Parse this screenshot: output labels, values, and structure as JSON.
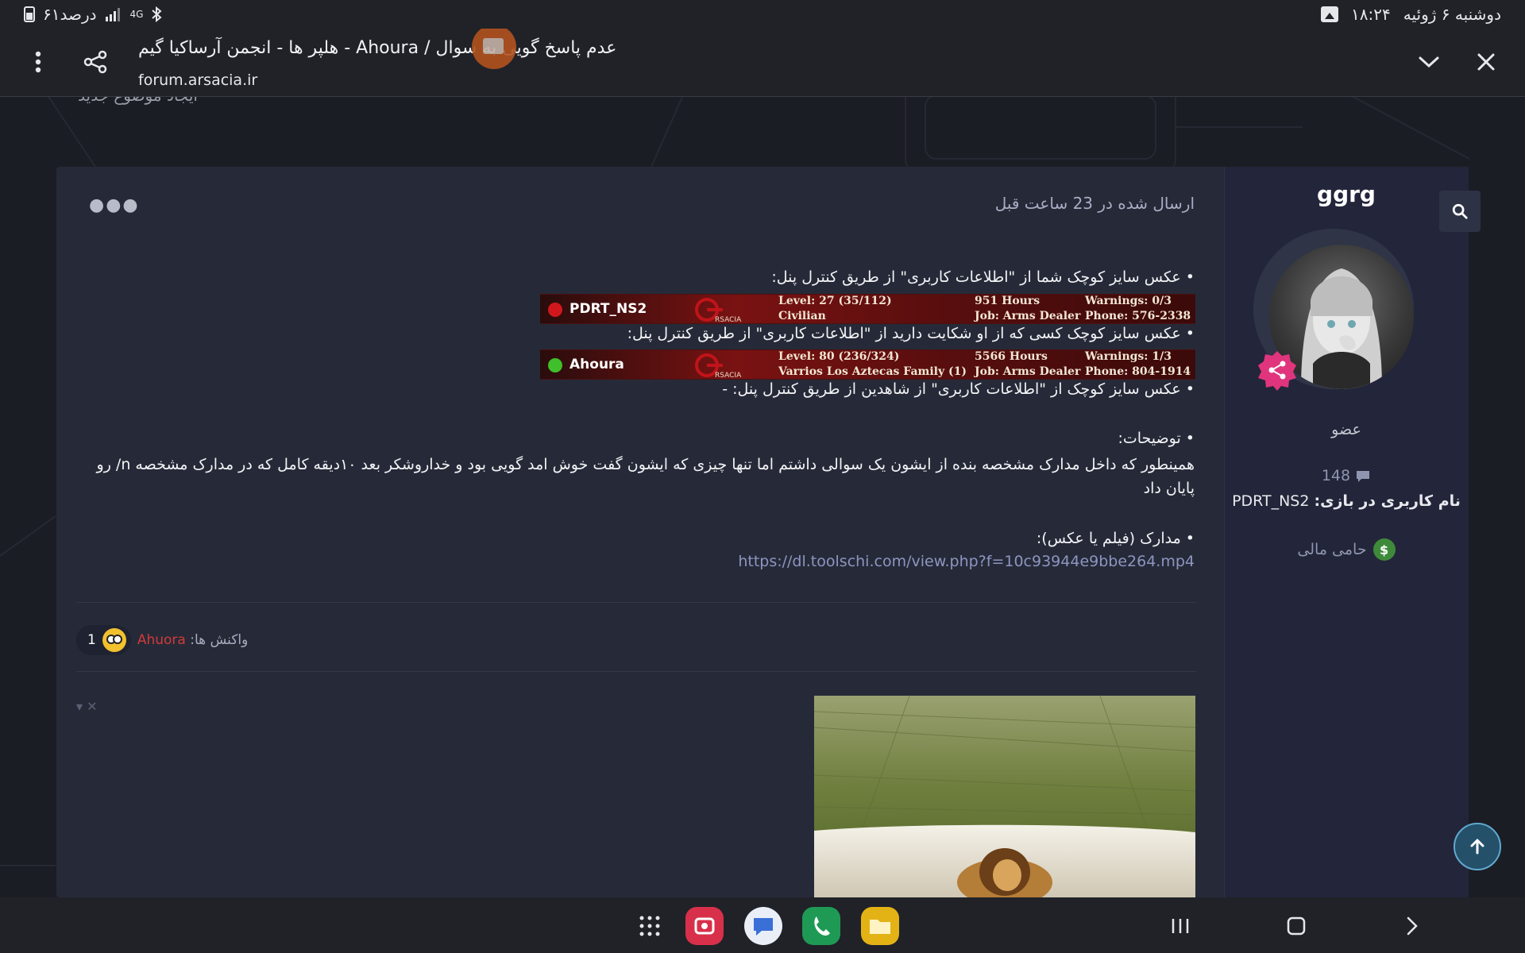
{
  "status_bar": {
    "battery_text": "۶۱درصد",
    "network": "4G",
    "time": "۱۸:۲۴",
    "date": "دوشنبه ۶ ژوئیه"
  },
  "custom_tab": {
    "title": "عدم پاسخ گویی به سوال / Ahoura - هلپر ها - انجمن آرساکیا گیم",
    "url": "forum.arsacia.ir"
  },
  "partial_text": "ایجاد موضوع جدید",
  "author": {
    "username": "ggrg",
    "role": "عضو",
    "post_count": "148",
    "ingame_label": "نام کاربری در بازی:",
    "ingame_name": "PDRT_NS2",
    "donor_label": "حامی مالی"
  },
  "post": {
    "posted_time": "ارسال شده در 23 ساعت قبل",
    "line1": "• عکس سایز کوچک شما از \"اطلاعات کاربری\" از طریق کنترل پنل:",
    "line2": "• عکس سایز کوچک کسی که از او شکایت دارید از \"اطلاعات کاربری\" از طریق کنترل پنل:",
    "line3": "• عکس سایز کوچک از \"اطلاعات کاربری\" از شاهدین از طریق کنترل پنل: -",
    "desc_label": "• توضیحات:",
    "desc_text": "همینطور که داخل مدارک مشخصه بنده از ایشون یک سوالی داشتم اما تنها چیزی که ایشون گفت خوش امد گویی بود و خداروشکر بعد ۱۰دیقه کامل که در مدارک مشخصه n/ رو پایان داد",
    "evidence_label": "• مدارک (فیلم یا عکس):",
    "evidence_link": "https://dl.toolschi.com/view.php?f=10c93944e9bbe264.mp4"
  },
  "signatures": [
    {
      "name": "PDRT_NS2",
      "status_color": "#d0181c",
      "level": "Level: 27 (35/112)",
      "faction": "Civilian",
      "hours": "951 Hours",
      "job": "Job: Arms Dealer",
      "warnings": "Warnings: 0/3",
      "phone": "Phone: 576-2338"
    },
    {
      "name": "Ahoura",
      "status_color": "#3fbf2a",
      "level": "Level: 80 (236/324)",
      "faction": "Varrios Los Aztecas Family (1)",
      "hours": "5566 Hours",
      "job": "Job: Arms Dealer",
      "warnings": "Warnings: 1/3",
      "phone": "Phone: 804-1914"
    }
  ],
  "reactions": {
    "count": "1",
    "label": "واکنش ها:",
    "who": "Ahuora"
  },
  "colors": {
    "page_bg": "#1b1d24",
    "card_bg": "#262a38",
    "link": "#8d95c0",
    "reaction_user": "#d23a3a",
    "share_badge": "#e0357d",
    "donor": "#3e8a3a"
  },
  "icons": {
    "more": "vertical-dots-icon",
    "share": "share-icon",
    "minimize": "chevron-down-icon",
    "close": "close-icon",
    "search": "search-icon",
    "scroll_top": "arrow-up-icon"
  },
  "nav_apps": [
    "apps-grid-icon",
    "screen-recorder-icon",
    "messages-icon",
    "phone-icon",
    "files-icon"
  ]
}
